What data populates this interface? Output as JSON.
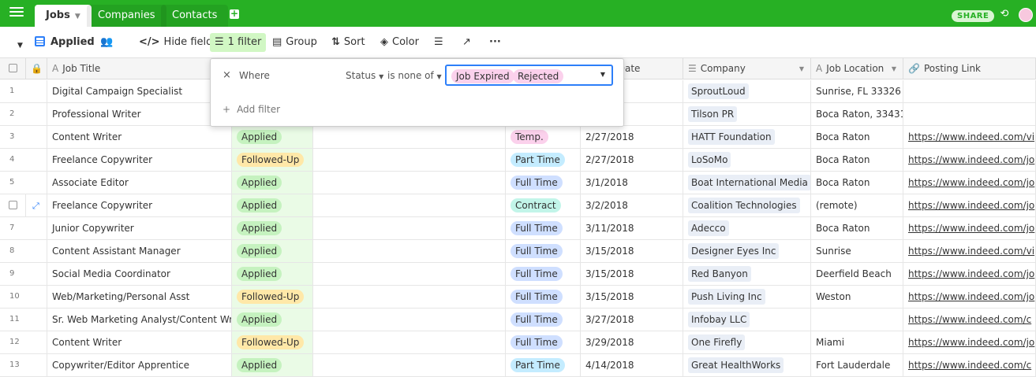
{
  "tabs": {
    "jobs": "Jobs",
    "companies": "Companies",
    "contacts": "Contacts"
  },
  "share_label": "SHARE",
  "toolbar": {
    "view_name": "Applied",
    "hide_fields": "Hide fields",
    "filter": "1 filter",
    "group": "Group",
    "sort": "Sort",
    "color": "Color"
  },
  "columns": {
    "job_title": "Job Title",
    "status": "",
    "type": "",
    "app_date": "cation Date",
    "company": "Company",
    "location": "Job Location",
    "link": "Posting Link"
  },
  "filter_popup": {
    "where": "Where",
    "field": "Status",
    "operator": "is none of",
    "values": [
      "Job Expired",
      "Rejected"
    ],
    "add_filter": "Add filter"
  },
  "rows": [
    {
      "n": "1",
      "title": "Digital Campaign Specialist",
      "status": "",
      "type": "",
      "date": "8",
      "company": "SproutLoud",
      "location": "Sunrise, FL 33326",
      "link": ""
    },
    {
      "n": "2",
      "title": "Professional Writer",
      "status": "",
      "type": "",
      "date": "8",
      "company": "Tilson PR",
      "location": "Boca Raton, 33431",
      "link": ""
    },
    {
      "n": "3",
      "title": "Content Writer",
      "status": "Applied",
      "type": "Temp.",
      "date": "2/27/2018",
      "company": "HATT Foundation",
      "location": "Boca Raton",
      "link": "https://www.indeed.com/vi"
    },
    {
      "n": "4",
      "title": "Freelance Copywriter",
      "status": "Followed-Up",
      "type": "Part Time",
      "date": "2/27/2018",
      "company": "LoSoMo",
      "location": "Boca Raton",
      "link": "https://www.indeed.com/jo"
    },
    {
      "n": "5",
      "title": "Associate Editor",
      "status": "Applied",
      "type": "Full Time",
      "date": "3/1/2018",
      "company": "Boat International Media",
      "location": "Boca Raton",
      "link": "https://www.indeed.com/jo"
    },
    {
      "n": "",
      "title": "Freelance Copywriter",
      "status": "Applied",
      "type": "Contract",
      "date": "3/2/2018",
      "company": "Coalition Technologies",
      "location": "(remote)",
      "link": "https://www.indeed.com/jo"
    },
    {
      "n": "7",
      "title": "Junior Copywriter",
      "status": "Applied",
      "type": "Full Time",
      "date": "3/11/2018",
      "company": "Adecco",
      "location": "Boca Raton",
      "link": "https://www.indeed.com/jo"
    },
    {
      "n": "8",
      "title": "Content Assistant Manager",
      "status": "Applied",
      "type": "Full Time",
      "date": "3/15/2018",
      "company": "Designer Eyes Inc",
      "location": "Sunrise",
      "link": "https://www.indeed.com/vi"
    },
    {
      "n": "9",
      "title": "Social Media Coordinator",
      "status": "Applied",
      "type": "Full Time",
      "date": "3/15/2018",
      "company": "Red Banyon",
      "location": "Deerfield Beach",
      "link": "https://www.indeed.com/jo"
    },
    {
      "n": "10",
      "title": "Web/Marketing/Personal Asst",
      "status": "Followed-Up",
      "type": "Full Time",
      "date": "3/15/2018",
      "company": "Push Living Inc",
      "location": "Weston",
      "link": "https://www.indeed.com/jo"
    },
    {
      "n": "11",
      "title": "Sr. Web Marketing Analyst/Content Writer",
      "status": "Applied",
      "type": "Full Time",
      "date": "3/27/2018",
      "company": "Infobay LLC",
      "location": "",
      "link": "https://www.indeed.com/c"
    },
    {
      "n": "12",
      "title": "Content Writer",
      "status": "Followed-Up",
      "type": "Full Time",
      "date": "3/29/2018",
      "company": "One Firefly",
      "location": "Miami",
      "link": "https://www.indeed.com/jo"
    },
    {
      "n": "13",
      "title": "Copywriter/Editor Apprentice",
      "status": "Applied",
      "type": "Part Time",
      "date": "4/14/2018",
      "company": "Great HealthWorks",
      "location": "Fort Lauderdale",
      "link": "https://www.indeed.com/c"
    }
  ]
}
